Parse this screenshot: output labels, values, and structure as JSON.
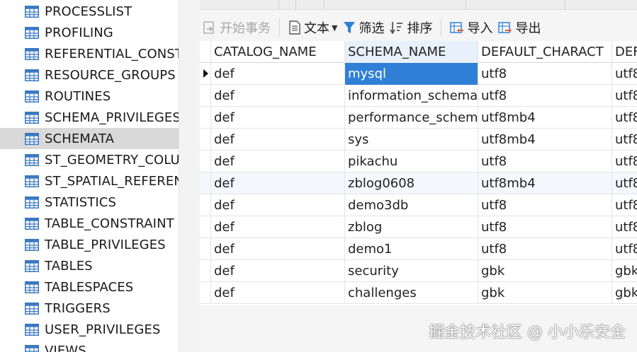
{
  "sidebar": {
    "items": [
      {
        "label": "PROCESSLIST",
        "selected": false
      },
      {
        "label": "PROFILING",
        "selected": false
      },
      {
        "label": "REFERENTIAL_CONST",
        "selected": false
      },
      {
        "label": "RESOURCE_GROUPS",
        "selected": false
      },
      {
        "label": "ROUTINES",
        "selected": false
      },
      {
        "label": "SCHEMA_PRIVILEGES",
        "selected": false
      },
      {
        "label": "SCHEMATA",
        "selected": true
      },
      {
        "label": "ST_GEOMETRY_COLU",
        "selected": false
      },
      {
        "label": "ST_SPATIAL_REFEREN",
        "selected": false
      },
      {
        "label": "STATISTICS",
        "selected": false
      },
      {
        "label": "TABLE_CONSTRAINT",
        "selected": false
      },
      {
        "label": "TABLE_PRIVILEGES",
        "selected": false
      },
      {
        "label": "TABLES",
        "selected": false
      },
      {
        "label": "TABLESPACES",
        "selected": false
      },
      {
        "label": "TRIGGERS",
        "selected": false
      },
      {
        "label": "USER_PRIVILEGES",
        "selected": false
      },
      {
        "label": "VIEWS",
        "selected": false
      }
    ],
    "item_icon": "table-icon"
  },
  "toolbar": {
    "begin_transaction": "开始事务",
    "text": "文本",
    "filter": "筛选",
    "sort": "排序",
    "import": "导入",
    "export": "导出"
  },
  "grid": {
    "columns": [
      "CATALOG_NAME",
      "SCHEMA_NAME",
      "DEFAULT_CHARACT",
      "DEF"
    ],
    "rows": [
      [
        "def",
        "mysql",
        "utf8",
        "utf8"
      ],
      [
        "def",
        "information_schema",
        "utf8",
        "utf8"
      ],
      [
        "def",
        "performance_schem",
        "utf8mb4",
        "utf8"
      ],
      [
        "def",
        "sys",
        "utf8mb4",
        "utf8"
      ],
      [
        "def",
        "pikachu",
        "utf8",
        "utf8"
      ],
      [
        "def",
        "zblog0608",
        "utf8mb4",
        "utf8"
      ],
      [
        "def",
        "demo3db",
        "utf8",
        "utf8"
      ],
      [
        "def",
        "zblog",
        "utf8",
        "utf8"
      ],
      [
        "def",
        "demo1",
        "utf8",
        "utf8"
      ],
      [
        "def",
        "security",
        "gbk",
        "gbk"
      ],
      [
        "def",
        "challenges",
        "gbk",
        "gbk"
      ]
    ],
    "current_row": 0,
    "active_cell_column": 1
  },
  "watermark": "掘金技术社区 @ 小小乐安全",
  "colors": {
    "selection": "#2f7fd6",
    "sidebar_selected": "#d9d9d9",
    "table_icon": "#3a78c2"
  }
}
